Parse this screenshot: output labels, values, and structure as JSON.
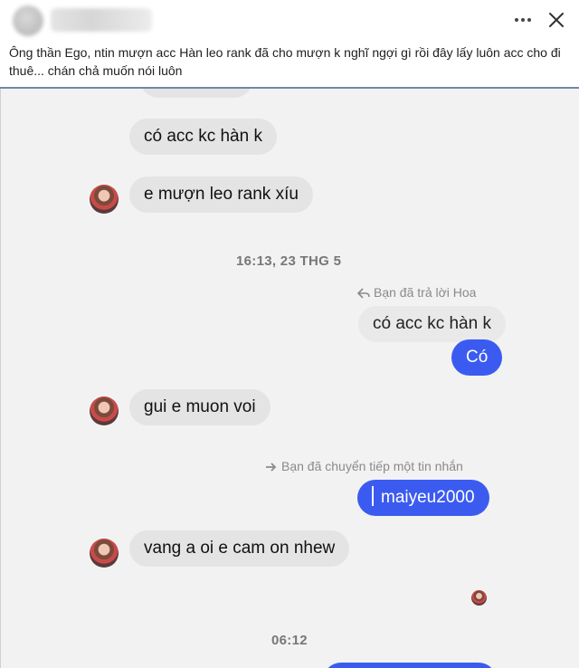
{
  "post": {
    "caption": "Ông thần Ego, ntin mượn acc Hàn leo rank đã cho mượn k nghĩ ngợi gì rồi đây lấy luôn acc cho đi thuê... chán chả muốn nói luôn"
  },
  "icons": {
    "more": "more-horizontal-icon",
    "close": "close-icon",
    "reply": "reply-arrow-icon",
    "forward": "forward-arrow-icon"
  },
  "chat": {
    "messages": [
      {
        "sender": "other",
        "text": "có acc kc hàn k"
      },
      {
        "sender": "other",
        "text": "e mượn leo rank xíu"
      },
      {
        "type": "timestamp",
        "text": "16:13, 23 THG 5"
      },
      {
        "type": "meta",
        "text": "Bạn đã trả lời Hoa"
      },
      {
        "sender": "quote",
        "text": "có acc kc hàn k"
      },
      {
        "sender": "me",
        "text": "Có"
      },
      {
        "sender": "other",
        "text": "gui e muon voi"
      },
      {
        "type": "meta",
        "text": "Bạn đã chuyển tiếp một tin nhắn"
      },
      {
        "sender": "me",
        "text": "maiyeu2000"
      },
      {
        "sender": "other",
        "text": "vang a oi e cam on nhew"
      },
      {
        "type": "timestamp",
        "text": "06:12"
      }
    ]
  },
  "colors": {
    "outgoing_bubble": "#3b5bf0",
    "incoming_bubble": "#e4e4e4",
    "chat_background": "#f2f2f2",
    "divider": "#6f88a8"
  }
}
